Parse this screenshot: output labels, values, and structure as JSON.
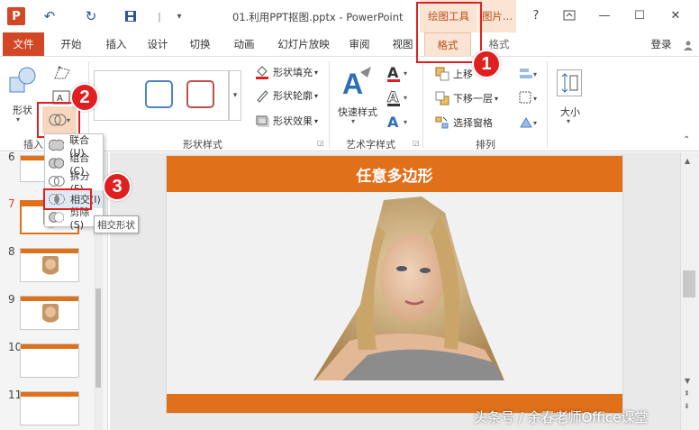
{
  "app": {
    "logo_letter": "P",
    "title": "01.利用PPT抠图.pptx - PowerPoint"
  },
  "context_tabs": {
    "drawing_tools": "绘图工具",
    "picture_tools": "图片..."
  },
  "window": {
    "help": "?",
    "restore_label": "☐",
    "minimize": "—",
    "maximize": "☐",
    "close": "✕"
  },
  "tabs": [
    "文件",
    "开始",
    "插入",
    "设计",
    "切换",
    "动画",
    "幻灯片放映",
    "审阅",
    "视图",
    "格式",
    "格式"
  ],
  "signin": "登录",
  "ribbon": {
    "insert_shapes": {
      "shapes_label": "形状",
      "group_label": "插入"
    },
    "shape_styles": {
      "fill": "形状填充",
      "outline": "形状轮廓",
      "effects": "形状效果",
      "group_label": "形状样式",
      "swatch_colors": [
        "#4a86c8",
        "#c0504d"
      ]
    },
    "wordart": {
      "quick_styles": "快速样式",
      "group_label": "艺术字样式"
    },
    "arrange": {
      "bring_forward": "上移",
      "send_backward": "下移一层",
      "selection_pane": "选择窗格",
      "group_label": "排列"
    },
    "size": {
      "label": "大小"
    }
  },
  "merge_menu": {
    "items": [
      "联合(U)",
      "组合(C)",
      "拆分(F)",
      "相交(I)",
      "剪除(S)"
    ],
    "tooltip": "相交形状"
  },
  "slides": {
    "numbers": [
      "6",
      "7",
      "8",
      "9",
      "10",
      "11"
    ]
  },
  "slide": {
    "title": "任意多边形"
  },
  "annotations": {
    "badge1": "1",
    "badge2": "2",
    "badge3": "3"
  },
  "watermark": "头条号 / 余春老师Office课堂",
  "colors": {
    "accent": "#d24726",
    "slide_orange": "#e1701a",
    "annotation_red": "#e02020"
  }
}
